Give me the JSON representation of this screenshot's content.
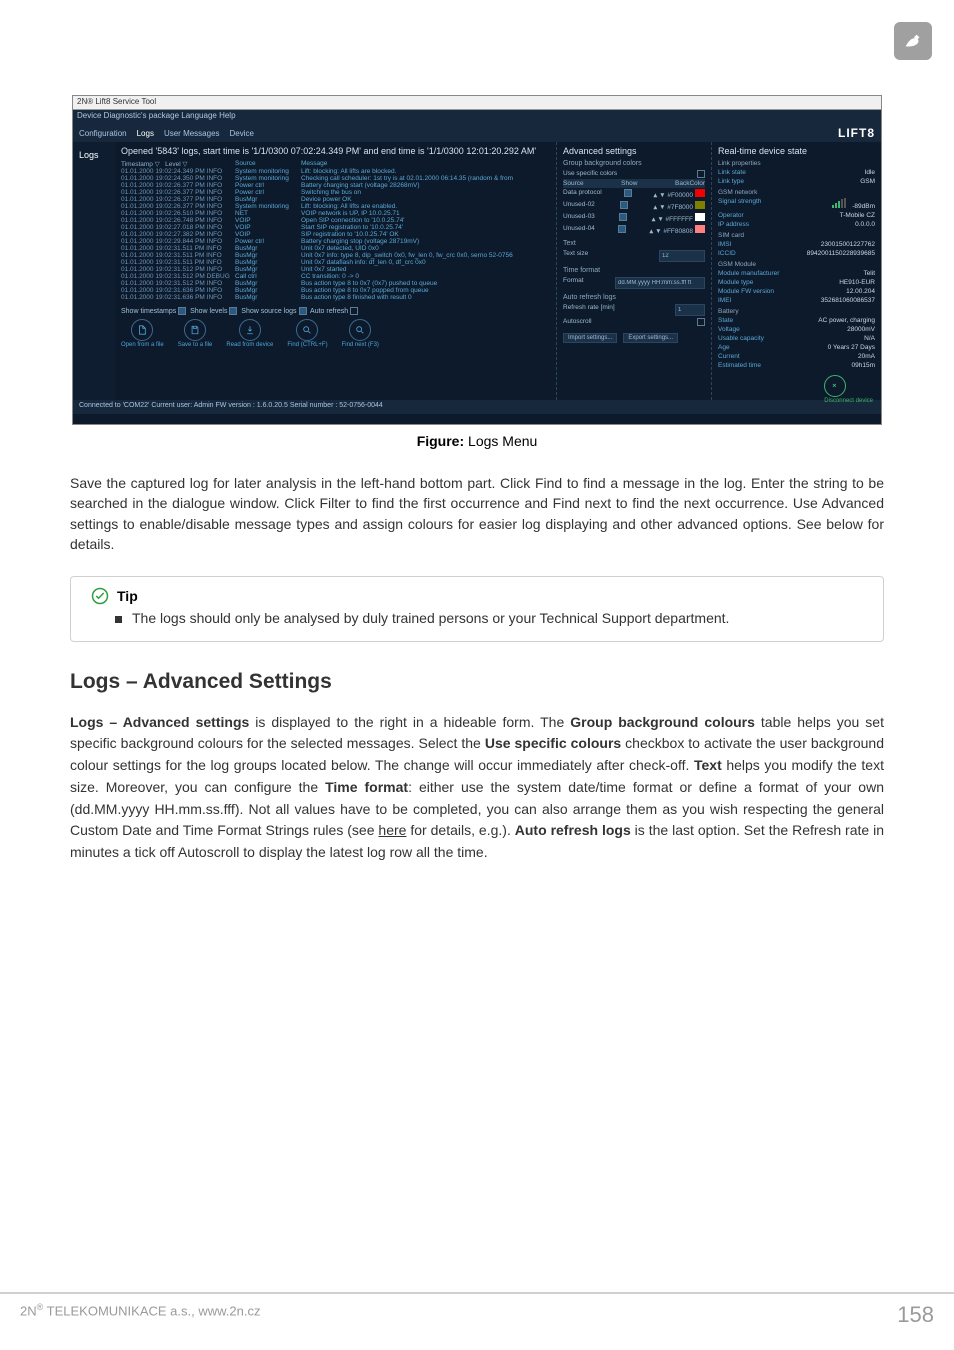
{
  "figure_caption_bold": "Figure:",
  "figure_caption_text": " Logs Menu",
  "paragraph1": "Save the captured log for later analysis in the left-hand bottom part. Click Find to find a message in the log. Enter the string to be searched in the dialogue window. Click Filter to find the first occurrence and Find next to find the next occurrence. Use Advanced settings to enable/disable message types and assign colours for easier log displaying and other advanced options. See below for details.",
  "tip_label": "Tip",
  "tip_text": "The logs should only be analysed by duly trained persons or your Technical Support department.",
  "section_title": "Logs – Advanced Settings",
  "p2_a": "Logs – Advanced settings",
  "p2_b": " is displayed to the right in a hideable form. The ",
  "p2_c": "Group background colours",
  "p2_d": " table helps you set specific background colours for the selected messages. Select the ",
  "p2_e": "Use specific colours",
  "p2_f": " checkbox to activate the user background colour settings for the log groups located below. The change will occur immediately after check-off. ",
  "p2_g": "Text",
  "p2_h": " helps you modify the text size. Moreover, you can configure the ",
  "p2_i": "Time format",
  "p2_j": ": either use the system date/time format or define a format of your own (dd.MM.yyyy HH.mm.ss.fff). Not all values have to be completed, you can also arrange them as you wish respecting the general Custom Date and Time Format Strings rules (see ",
  "p2_k": "here",
  "p2_l": " for details, e.g.). ",
  "p2_m": "Auto refresh logs",
  "p2_n": " is the last option. Set the Refresh rate in minutes a tick off Autoscroll to display the latest log row all the time.",
  "footer_left_a": "2N",
  "footer_left_b": "®",
  "footer_left_c": " TELEKOMUNIKACE a.s., www.2n.cz",
  "footer_page": "158",
  "ss": {
    "title": "2N® Lift8 Service Tool",
    "menu": "Device   Diagnostic's package   Language   Help",
    "tabs": [
      "Configuration",
      "Logs",
      "User Messages",
      "Device"
    ],
    "logo": "LIFT8",
    "left_label": "Logs",
    "center_header": "Opened '5843' logs, start time is '1/1/0300 07:02:24.349 PM' and end time is '1/1/0300 12:01:20.292 AM'",
    "cols": {
      "ts": "Timestamp",
      "lv": "Level",
      "src": "Source",
      "msg": "Message"
    },
    "rows": [
      {
        "ts": "01.01.2000 19:02:24.349 PM INFO",
        "src": "System monitoring",
        "msg": "Lift: blocking: All lifts are blocked."
      },
      {
        "ts": "01.01.2000 19:02:24.350 PM INFO",
        "src": "System monitoring",
        "msg": "Checking call scheduler: 1st try is at 02.01.2000 06:14.35 (random & from"
      },
      {
        "ts": "01.01.2000 19:02:26.377 PM INFO",
        "src": "Power ctrl",
        "msg": "Battery charging start (voltage 28268mV)"
      },
      {
        "ts": "01.01.2000 19:02:26.377 PM INFO",
        "src": "Power ctrl",
        "msg": "Switching the bus on"
      },
      {
        "ts": "01.01.2000 19:02:26.377 PM INFO",
        "src": "BusMgr",
        "msg": "Device power OK"
      },
      {
        "ts": "01.01.2000 19:02:26.377 PM INFO",
        "src": "System monitoring",
        "msg": "Lift: blocking: All lifts are enabled."
      },
      {
        "ts": "01.01.2000 19:02:26.510 PM INFO",
        "src": "NET",
        "msg": "VOIP network is UP, IP 10.0.25.71"
      },
      {
        "ts": "01.01.2000 19:02:26.748 PM INFO",
        "src": "VOIP",
        "msg": "Open SIP connection to '10.0.25.74'"
      },
      {
        "ts": "01.01.2000 19:02:27.018 PM INFO",
        "src": "VOIP",
        "msg": "Start SIP registration to '10.0.25.74'"
      },
      {
        "ts": "01.01.2000 19:02:27.382 PM INFO",
        "src": "VOIP",
        "msg": "SIP registration to '10.0.25.74' OK"
      },
      {
        "ts": "01.01.2000 19:02:29.844 PM INFO",
        "src": "Power ctrl",
        "msg": "Battery charging stop (voltage 28719mV)"
      },
      {
        "ts": "01.01.2000 19:02:31.511 PM  INFO",
        "src": "BusMgr",
        "msg": "Unit 0x7 detected, UID 0x0"
      },
      {
        "ts": "01.01.2000 19:02:31.511 PM  INFO",
        "src": "BusMgr",
        "msg": "Unit 0x7 info: type 8, dip_switch 0x0, fw_len 0, fw_crc 0x0, serno 52-0756"
      },
      {
        "ts": "01.01.2000 19:02:31.511 PM  INFO",
        "src": "BusMgr",
        "msg": "Unit 0x7 dataflash info: df_len 0, df_crc 0x0"
      },
      {
        "ts": "01.01.2000 19:02:31.512 PM  INFO",
        "src": "BusMgr",
        "msg": "Unit 0x7 started"
      },
      {
        "ts": "01.01.2000 19:02:31.512 PM  DEBUG",
        "src": "Call ctrl",
        "msg": "CC transition: 0 -> 0"
      },
      {
        "ts": "01.01.2000 19:02:31.512 PM  INFO",
        "src": "BusMgr",
        "msg": "Bus action type 8 to 0x7 (0x7) pushed to queue"
      },
      {
        "ts": "01.01.2000 19:02:31.636 PM  INFO",
        "src": "BusMgr",
        "msg": "Bus action type 8 to 0x7 popped from queue"
      },
      {
        "ts": "01.01.2000 19:02:31.636 PM  INFO",
        "src": "BusMgr",
        "msg": "Bus action type 8 finished with result 0"
      }
    ],
    "footer_opts": {
      "a": "Show timestamps",
      "b": "Show levels",
      "c": "Show source logs",
      "d": "Auto refresh"
    },
    "btn_labels": {
      "open": "Open from a file",
      "save": "Save to a file",
      "read": "Read from device",
      "find": "Find (CTRL+F)",
      "next": "Find next (F3)"
    },
    "as": {
      "title": "Advanced settings",
      "group": "Group background colors",
      "usespec": "Use specific colors",
      "hdr_source": "Source",
      "hdr_show": "Show",
      "hdr_bc": "BackColor",
      "rows": [
        {
          "n": "Data protocol",
          "c": "#F00000"
        },
        {
          "n": "Unused-02",
          "c": "#7F8000"
        },
        {
          "n": "Unused-03",
          "c": "#FFFFFF"
        },
        {
          "n": "Unused-04",
          "c": "#FF80808"
        }
      ],
      "text": "Text",
      "textsize": "Text size",
      "textsizeval": "12",
      "timefmt": "Time format",
      "fmt": "Format",
      "fmtval": "dd.MM.yyyy HH:mm:ss.fff ft",
      "arl": "Auto refresh logs",
      "rate": "Refresh rate [min]",
      "rateval": "1",
      "auto": "Autoscroll",
      "import": "Import settings...",
      "export": "Export settings..."
    },
    "rt": {
      "title": "Real-time device state",
      "groups": {
        "linkprops": "Link properties",
        "gsmnet": "GSM network",
        "sim": "SIM card",
        "gsmmod": "GSM Module",
        "battery": "Battery"
      },
      "rows": {
        "linkstate_l": "Link state",
        "linkstate_v": "Idle",
        "linktype_l": "Link type",
        "linktype_v": "GSM",
        "sig_l": "Signal strength",
        "sig_v": "-89dBm",
        "op_l": "Operator",
        "op_v": "T-Mobile CZ",
        "ip_l": "IP address",
        "ip_v": "0.0.0.0",
        "imsi_l": "IMSI",
        "imsi_v": "230015001227762",
        "iccid_l": "ICCID",
        "iccid_v": "8942001150228939685",
        "mmfr_l": "Module manufacturer",
        "mmfr_v": "Telit",
        "mtype_l": "Module type",
        "mtype_v": "HE910-EUR",
        "mfw_l": "Module FW version",
        "mfw_v": "12.00.204",
        "imei_l": "IMEI",
        "imei_v": "352681060086537",
        "bstate_l": "State",
        "bstate_v": "AC power, charging",
        "volt_l": "Voltage",
        "volt_v": "28000mV",
        "cap_l": "Usable capacity",
        "cap_v": "N/A",
        "age_l": "Age",
        "age_v": "0 Years 27 Days",
        "cur_l": "Current",
        "cur_v": "20mA",
        "est_l": "Estimated time",
        "est_v": "09h15m"
      },
      "disc": "Disconnect device"
    },
    "status": "Connected to 'COM22'  Current user: Admin  FW version : 1.6.0.20.5  Serial number : 52-0756-0044"
  }
}
